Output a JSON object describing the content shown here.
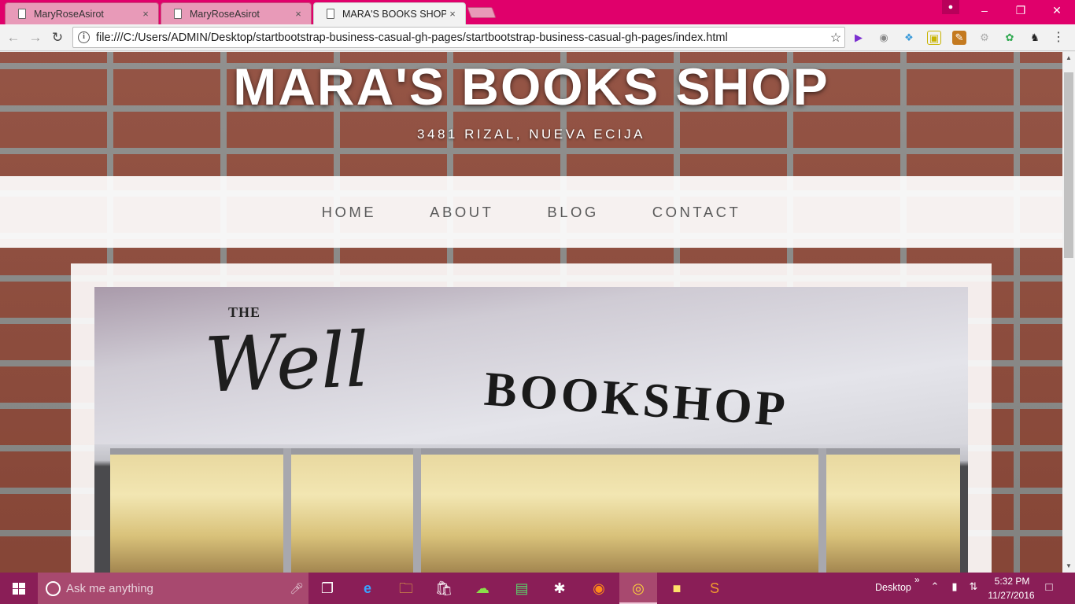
{
  "browser": {
    "tabs": [
      {
        "title": "MaryRoseAsirot",
        "active": false
      },
      {
        "title": "MaryRoseAsirot",
        "active": false
      },
      {
        "title": "MARA'S BOOKS SHOP",
        "active": true
      }
    ],
    "tab_close_glyph": "×",
    "url": "file:///C:/Users/ADMIN/Desktop/startbootstrap-business-casual-gh-pages/startbootstrap-business-casual-gh-pages/index.html",
    "accent_color": "#e0006b",
    "nav_icons": [
      "back-arrow-icon",
      "forward-arrow-icon",
      "reload-icon"
    ],
    "extension_icons": [
      "play-extension-icon",
      "globe-extension-icon",
      "evernote-extension-icon",
      "screenshot-extension-icon",
      "edit-extension-icon",
      "gear-extension-icon",
      "color-extension-icon",
      "puzzle-extension-icon",
      "menu-icon"
    ]
  },
  "site": {
    "title": "MARA'S BOOKS SHOP",
    "address": "3481 RIZAL, NUEVA ECIJA",
    "nav": [
      {
        "label": "HOME"
      },
      {
        "label": "ABOUT"
      },
      {
        "label": "BLOG"
      },
      {
        "label": "CONTACT"
      }
    ],
    "hero_image": {
      "sign_small": "THE",
      "sign_script": "Well",
      "sign_main": "BOOKSHOP"
    }
  },
  "taskbar": {
    "search_placeholder": "Ask me anything",
    "pinned_apps": [
      "task-view-icon",
      "edge-icon",
      "file-explorer-icon",
      "store-icon",
      "cloud-app-icon",
      "notepad-app-icon",
      "bluetooth-icon",
      "firefox-icon",
      "chrome-icon",
      "sticky-notes-icon",
      "sublime-text-icon"
    ],
    "active_app": "chrome-icon",
    "desktop_label": "Desktop",
    "time": "5:32 PM",
    "date": "11/27/2016",
    "color": "#8a1e57"
  }
}
